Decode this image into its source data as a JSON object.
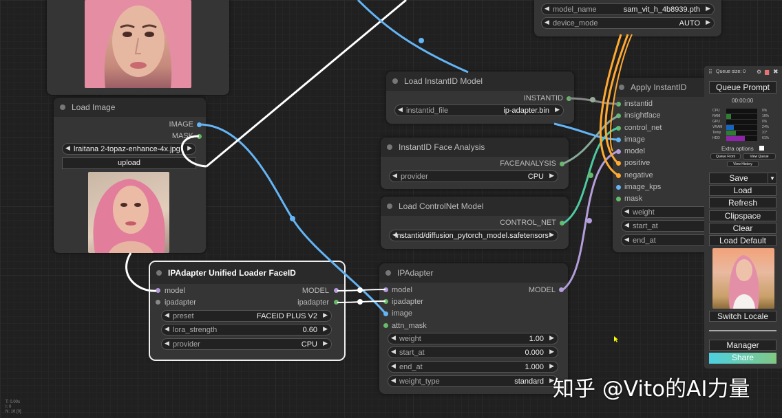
{
  "nodes": {
    "load_image": {
      "title": "Load Image",
      "outputs": [
        "IMAGE",
        "MASK"
      ],
      "image_file": "lraitana 2-topaz-enhance-4x.jpg",
      "upload_label": "upload"
    },
    "ipadapter_loader": {
      "title": "IPAdapter Unified Loader FaceID",
      "inputs": [
        "model",
        "ipadapter"
      ],
      "outputs": [
        "MODEL",
        "ipadapter"
      ],
      "widgets": [
        {
          "label": "preset",
          "value": "FACEID PLUS V2"
        },
        {
          "label": "lora_strength",
          "value": "0.60"
        },
        {
          "label": "provider",
          "value": "CPU"
        }
      ]
    },
    "load_instantid": {
      "title": "Load InstantID Model",
      "output": "INSTANTID",
      "widget": {
        "label": "instantid_file",
        "value": "ip-adapter.bin"
      }
    },
    "face_analysis": {
      "title": "InstantID Face Analysis",
      "output": "FACEANALYSIS",
      "widget": {
        "label": "provider",
        "value": "CPU"
      }
    },
    "controlnet": {
      "title": "Load ControlNet Model",
      "output": "CONTROL_NET",
      "widget_value": "instantid/diffusion_pytorch_model.safetensors"
    },
    "ipadapter": {
      "title": "IPAdapter",
      "inputs": [
        "model",
        "ipadapter",
        "image",
        "attn_mask"
      ],
      "output": "MODEL",
      "widgets": [
        {
          "label": "weight",
          "value": "1.00"
        },
        {
          "label": "start_at",
          "value": "0.000"
        },
        {
          "label": "end_at",
          "value": "1.000"
        },
        {
          "label": "weight_type",
          "value": "standard"
        }
      ]
    },
    "apply_instantid": {
      "title": "Apply InstantID",
      "inputs": [
        "instantid",
        "insightface",
        "control_net",
        "image",
        "model",
        "positive",
        "negative",
        "image_kps",
        "mask"
      ],
      "widgets": [
        "weight",
        "start_at",
        "end_at"
      ]
    },
    "sam_loader": {
      "widgets": [
        {
          "label": "model_name",
          "value": "sam_vit_h_4b8939.pth"
        },
        {
          "label": "device_mode",
          "value": "AUTO"
        }
      ]
    }
  },
  "menu": {
    "queue_size": "Queue size: 0",
    "queue_prompt": "Queue Prompt",
    "timer": "00:00:00",
    "stats": [
      {
        "label": "CPU",
        "pct": "0%",
        "level": 0,
        "color": "#2e7d32"
      },
      {
        "label": "RAM",
        "pct": "16%",
        "level": 16,
        "color": "#2e7d32"
      },
      {
        "label": "GPU",
        "pct": "0%",
        "level": 0,
        "color": "#2e7d32"
      },
      {
        "label": "VRAM",
        "pct": "24%",
        "level": 24,
        "color": "#1565c0"
      },
      {
        "label": "Temp",
        "pct": "31°",
        "level": 31,
        "color": "#2e7d32"
      },
      {
        "label": "HDD",
        "pct": "61%",
        "level": 61,
        "color": "#8e24aa"
      }
    ],
    "extra_options": "Extra options",
    "queue_front": "Queue Front",
    "view_queue": "View Queue",
    "view_history": "View History",
    "save": "Save",
    "load": "Load",
    "refresh": "Refresh",
    "clipspace": "Clipspace",
    "clear": "Clear",
    "load_default": "Load Default",
    "switch_locale": "Switch Locale",
    "manager": "Manager",
    "share": "Share"
  },
  "watermark": "知乎 @Vito的AI力量",
  "stats_corner": [
    "T: 0.00s",
    "I: 0",
    "N: 16 [0]"
  ],
  "colors": {
    "model_socket": "#b39ddb",
    "image_socket": "#64b5f6",
    "generic_socket": "#66bb6a",
    "conditioning_wire": "#ffa931",
    "share_gradient": "#4dd0e1"
  }
}
